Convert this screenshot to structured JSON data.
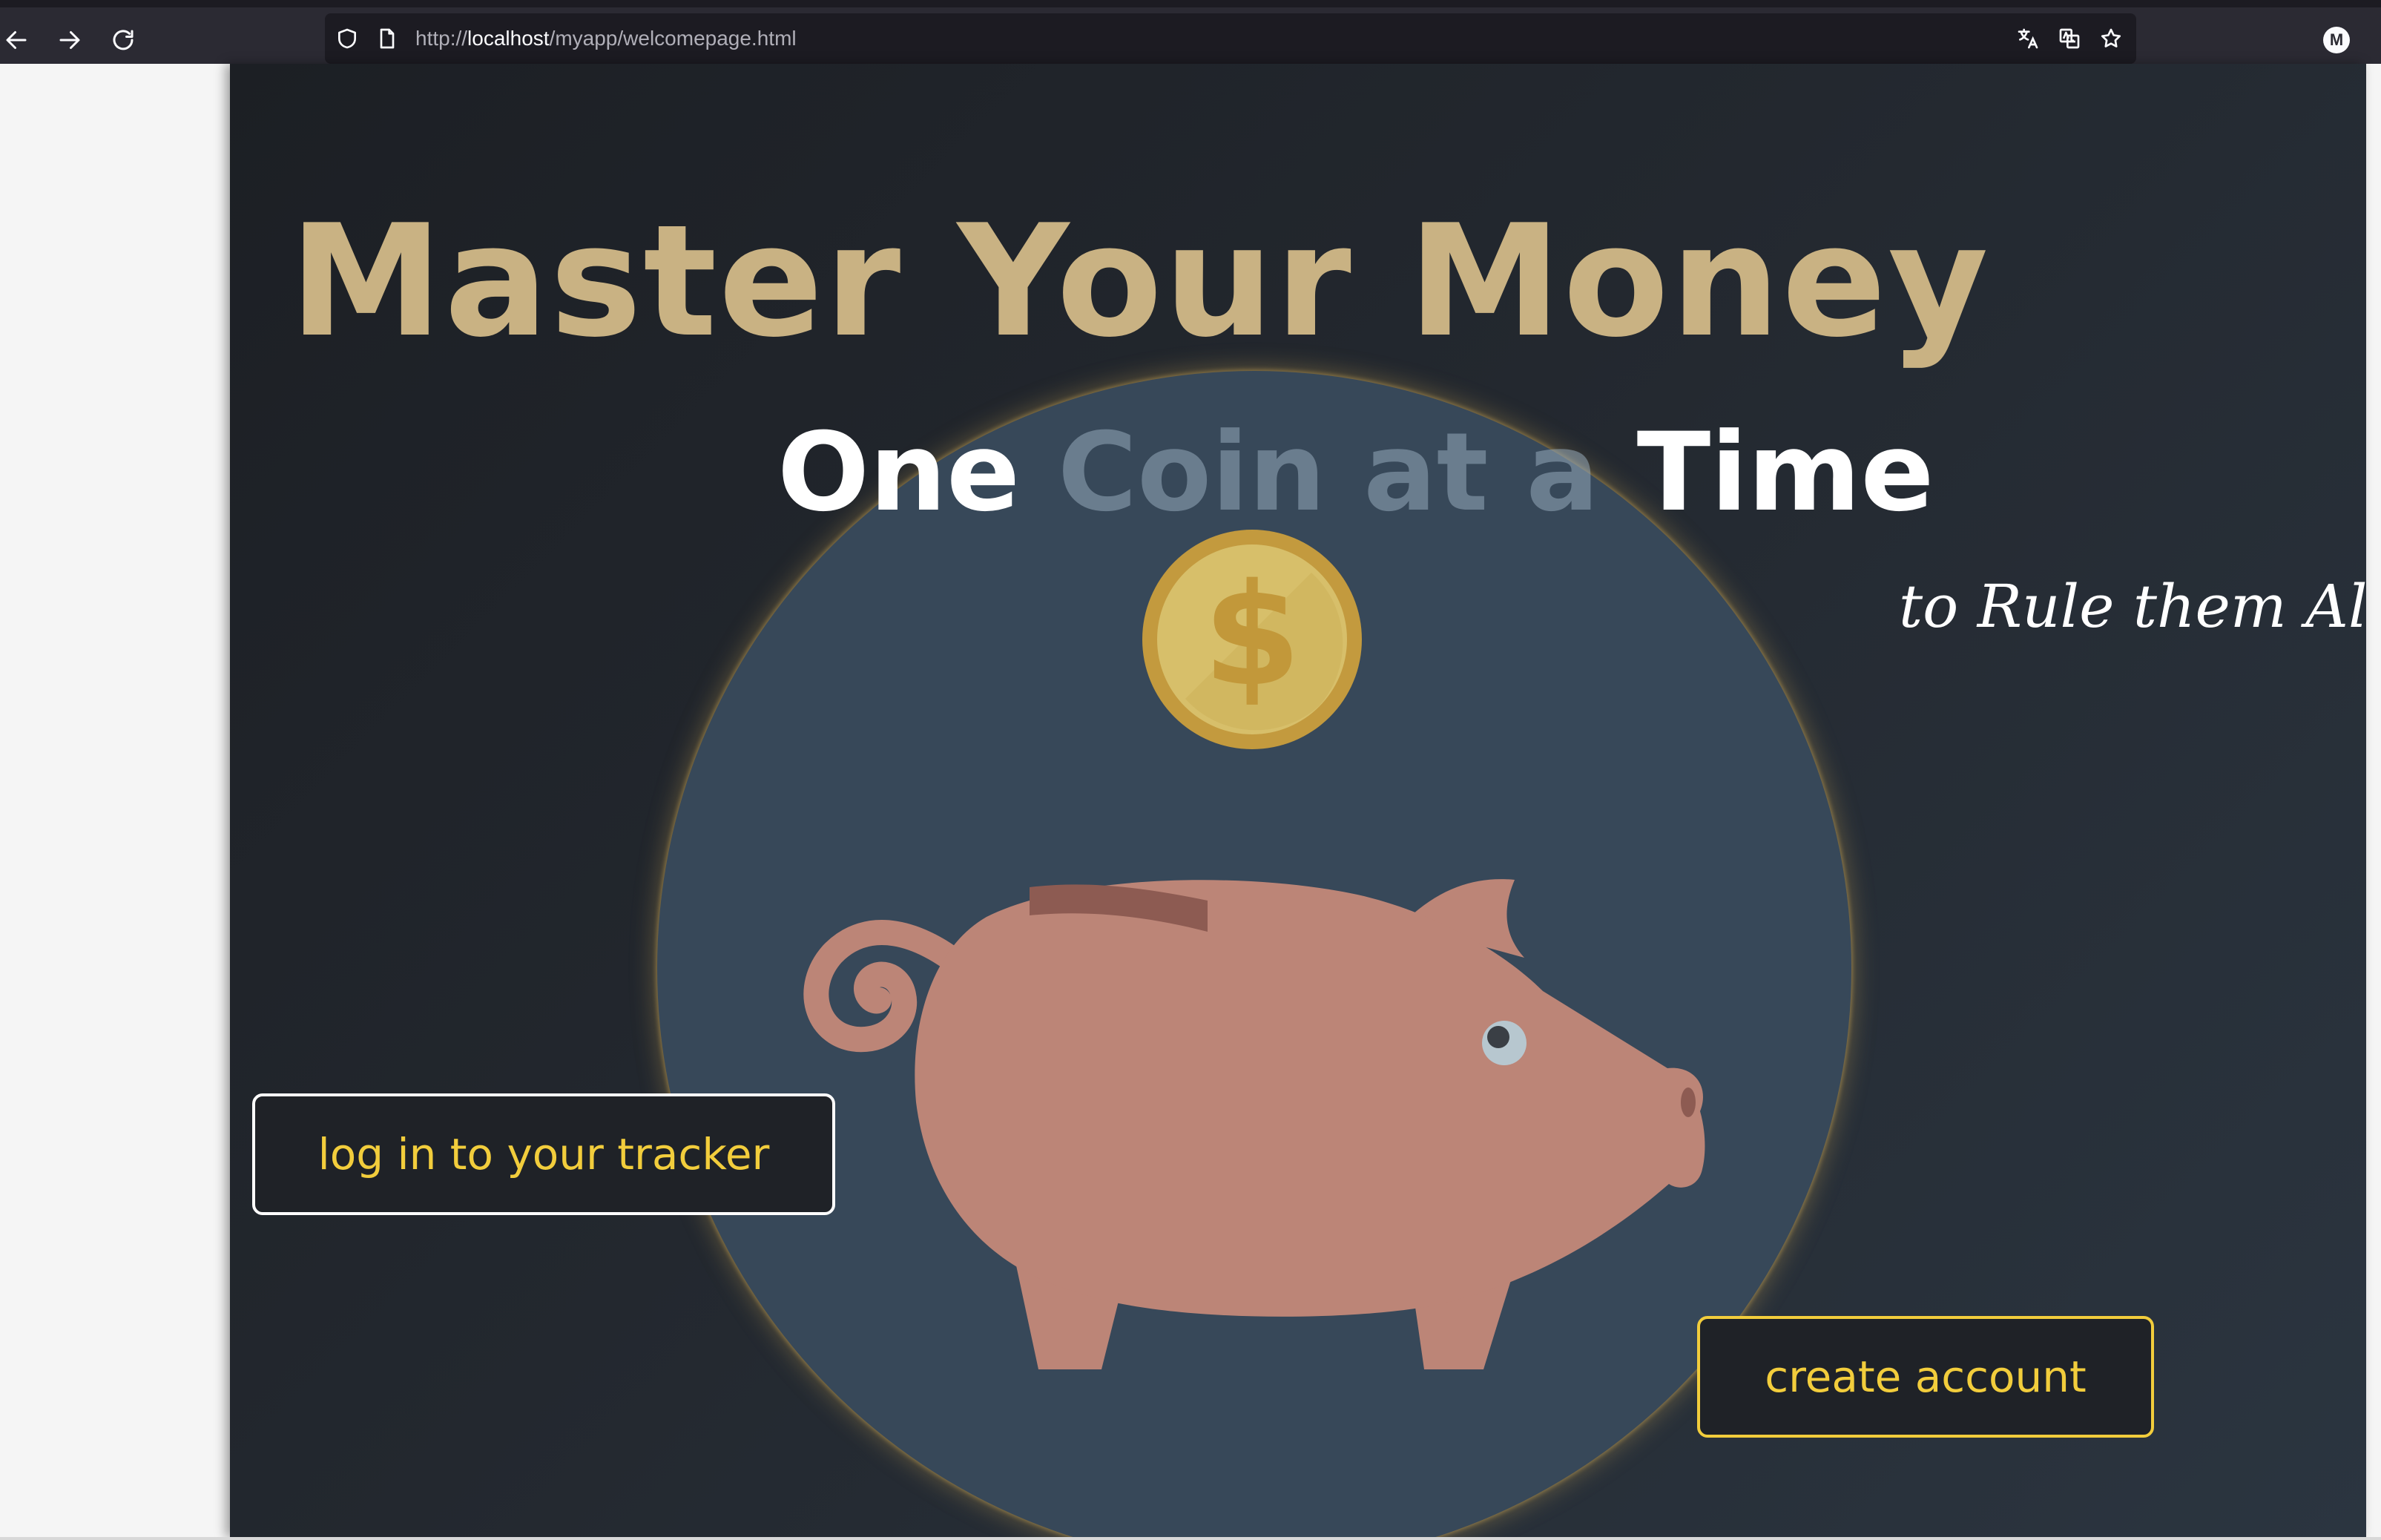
{
  "browser": {
    "url_scheme": "http://",
    "url_host": "localhost",
    "url_path": "/myapp/welcomepage.html",
    "profile_initial": "M",
    "icons": [
      "back-arrow-icon",
      "forward-arrow-icon",
      "reload-icon",
      "shield-icon",
      "page-icon",
      "translate-icon",
      "translate-page-icon",
      "star-icon",
      "profile-icon"
    ]
  },
  "hero": {
    "headline": "Master Your Money",
    "subtitle_part1": "One ",
    "subtitle_part2": "Coin at a",
    "subtitle_part3": " Time",
    "tagline": "to Rule them All!",
    "coin_symbol": "$"
  },
  "buttons": {
    "login_label": "log in to your tracker",
    "create_label": "create account"
  },
  "colors": {
    "headline": "#c9b283",
    "button_text": "#f2cd3c",
    "circle": "#374859",
    "pig": "#bc8577",
    "coin": "#c9a448"
  }
}
